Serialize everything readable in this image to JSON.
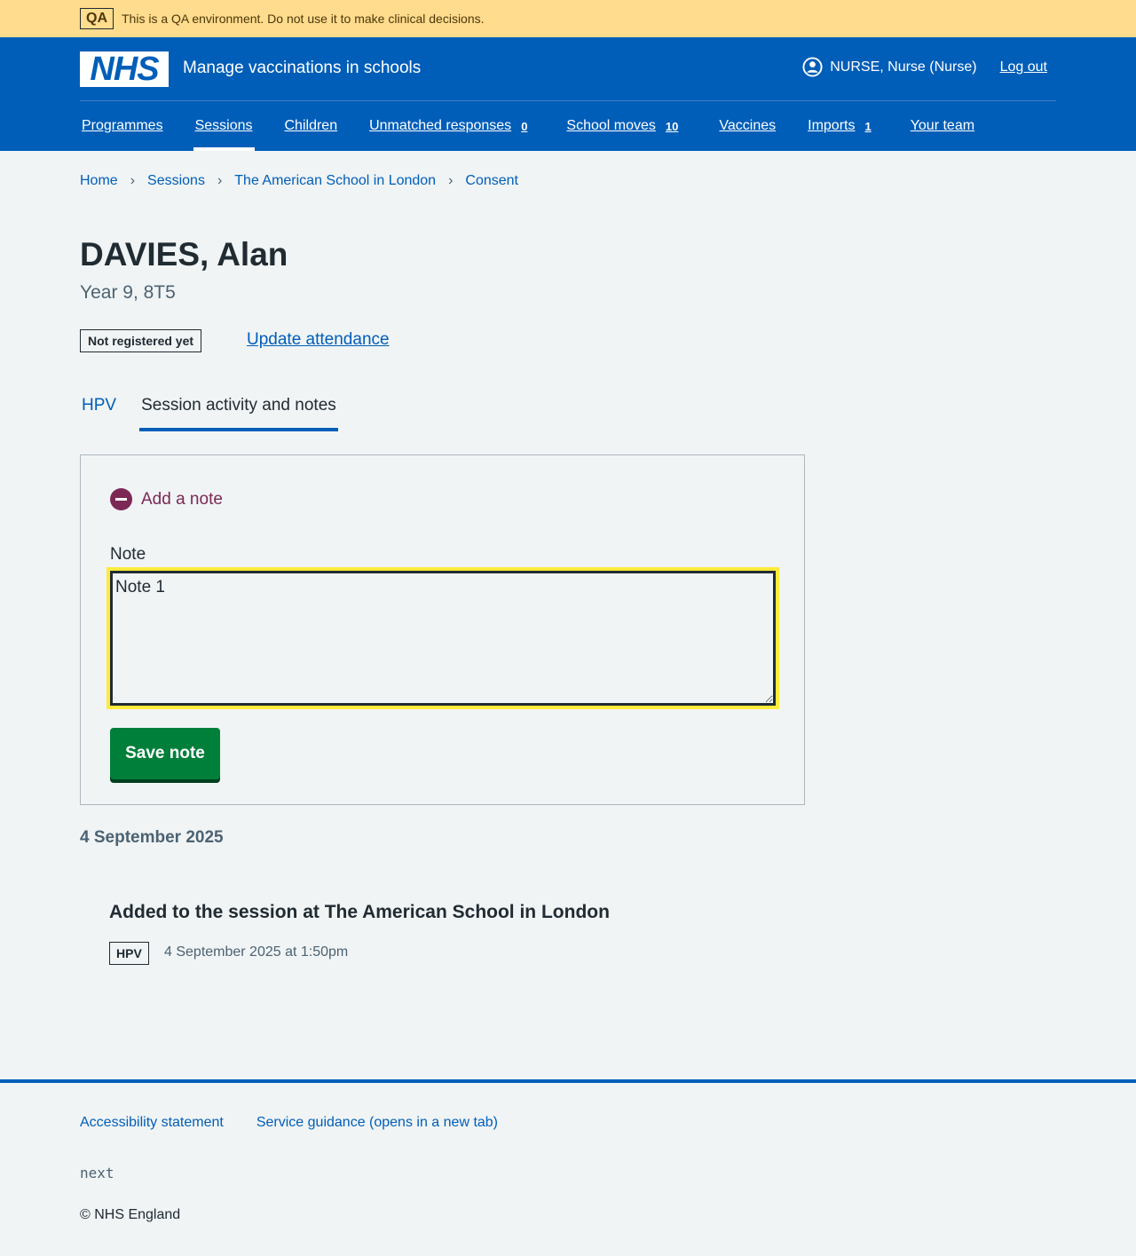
{
  "qa_banner": {
    "tag": "QA",
    "text": "This is a QA environment. Do not use it to make clinical decisions."
  },
  "header": {
    "logo_text": "NHS",
    "service_name": "Manage vaccinations in schools",
    "user_name": "NURSE, Nurse (Nurse)",
    "logout_label": "Log out",
    "nav": [
      {
        "label": "Programmes",
        "count": ""
      },
      {
        "label": "Sessions",
        "count": "",
        "active": true
      },
      {
        "label": "Children",
        "count": ""
      },
      {
        "label": "Unmatched responses",
        "count": "0"
      },
      {
        "label": "School moves",
        "count": "10"
      },
      {
        "label": "Vaccines",
        "count": ""
      },
      {
        "label": "Imports",
        "count": "1"
      },
      {
        "label": "Your team",
        "count": ""
      }
    ]
  },
  "breadcrumb": [
    "Home",
    "Sessions",
    "The American School in London",
    "Consent"
  ],
  "patient": {
    "name": "DAVIES, Alan",
    "subtitle": "Year 9, 8T5",
    "status": "Not registered yet",
    "attendance_link": "Update attendance"
  },
  "tabs": [
    {
      "label": "HPV",
      "active": false
    },
    {
      "label": "Session activity and notes",
      "active": true
    }
  ],
  "note_form": {
    "summary": "Add a note",
    "label": "Note",
    "value": "Note 1",
    "save_label": "Save note"
  },
  "activity": {
    "date_heading": "4 September 2025",
    "events": [
      {
        "title": "Added to the session at The American School in London",
        "tag": "HPV",
        "time": "4 September 2025 at 1:50pm"
      }
    ]
  },
  "footer": {
    "links": [
      "Accessibility statement",
      "Service guidance (opens in a new tab)"
    ],
    "version": "next",
    "copyright": "© NHS England"
  },
  "colors": {
    "nhs_blue": "#005eb8",
    "qa_yellow": "#ffdc8e",
    "focus_yellow": "#ffeb3b",
    "button_green": "#007f3b",
    "plum": "#7c2855"
  }
}
